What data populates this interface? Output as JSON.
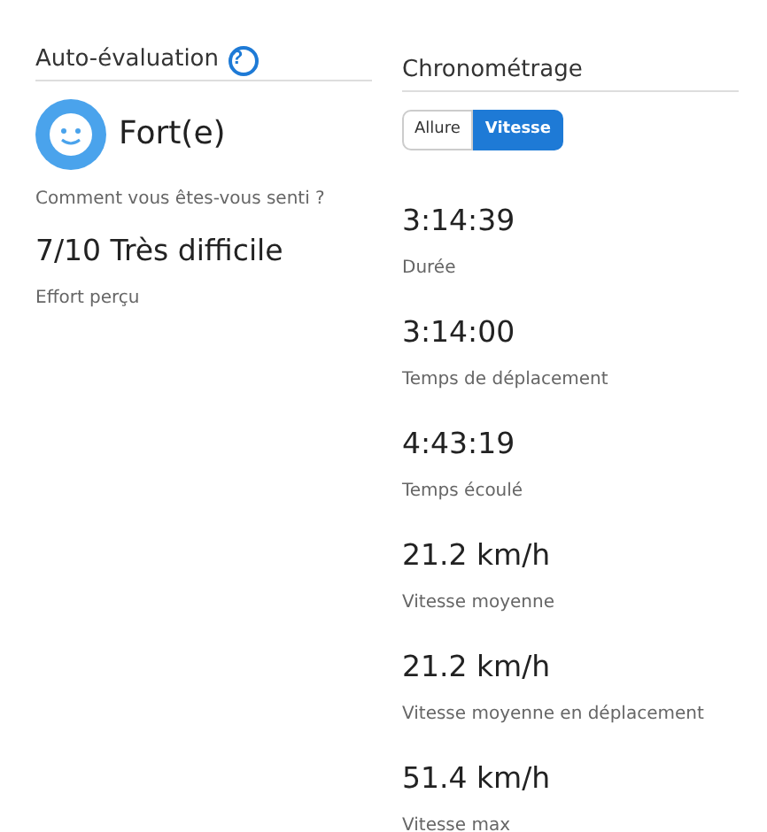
{
  "self_evaluation": {
    "title": "Auto-évaluation",
    "help_icon": "?",
    "feeling": "Fort(e)",
    "feeling_label": "Comment vous êtes-vous senti ?",
    "effort": "7/10 Très difficile",
    "effort_label": "Effort perçu"
  },
  "timing": {
    "title": "Chronométrage",
    "toggle": [
      {
        "label": "Allure",
        "selected": false
      },
      {
        "label": "Vitesse",
        "selected": true
      }
    ],
    "stats": [
      {
        "value": "3:14:39",
        "label": "Durée"
      },
      {
        "value": "3:14:00",
        "label": "Temps de déplacement"
      },
      {
        "value": "4:43:19",
        "label": "Temps écoulé"
      },
      {
        "value": "21.2 km/h",
        "label": "Vitesse moyenne"
      },
      {
        "value": "21.2 km/h",
        "label": "Vitesse moyenne en déplacement"
      },
      {
        "value": "51.4 km/h",
        "label": "Vitesse max"
      }
    ]
  }
}
